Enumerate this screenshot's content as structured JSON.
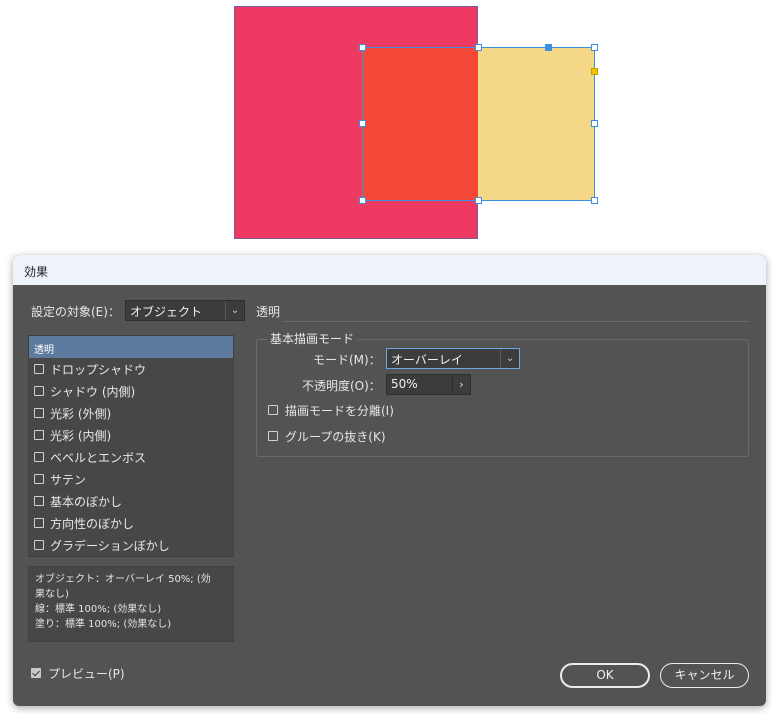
{
  "canvas": {
    "colors": {
      "back_square": "#ee3a63",
      "overlap_square": "#f64836",
      "front_square": "#f5d788",
      "selection": "#3d8fe0",
      "frame_stroke": "#7a5ba0"
    }
  },
  "dialog": {
    "title": "効果",
    "target_label": "設定の対象(E)：",
    "target_value": "オブジェクト",
    "section_header": "透明",
    "effects_list": [
      {
        "label": "透明",
        "selected": true,
        "has_checkbox": false
      },
      {
        "label": "ドロップシャドウ",
        "checked": false
      },
      {
        "label": "シャドウ (内側)",
        "checked": false
      },
      {
        "label": "光彩 (外側)",
        "checked": false
      },
      {
        "label": "光彩 (内側)",
        "checked": false
      },
      {
        "label": "ベベルとエンボス",
        "checked": false
      },
      {
        "label": "サテン",
        "checked": false
      },
      {
        "label": "基本のぼかし",
        "checked": false
      },
      {
        "label": "方向性のぼかし",
        "checked": false
      },
      {
        "label": "グラデーションぼかし",
        "checked": false
      }
    ],
    "summary": {
      "line1": "オブジェクト：オーバーレイ 50%; (効",
      "line2": "果なし)",
      "line3": "線：標準 100%; (効果なし)",
      "line4": "塗り：標準 100%; (効果なし)"
    },
    "blend_group": {
      "title": "基本描画モード",
      "mode_label": "モード(M)：",
      "mode_value": "オーバーレイ",
      "opacity_label": "不透明度(O)：",
      "opacity_value": "50%",
      "isolate_label": "描画モードを分離(I)",
      "knockout_label": "グループの抜き(K)"
    },
    "preview_label": "プレビュー(P)",
    "preview_checked": true,
    "ok_label": "OK",
    "cancel_label": "キャンセル"
  }
}
